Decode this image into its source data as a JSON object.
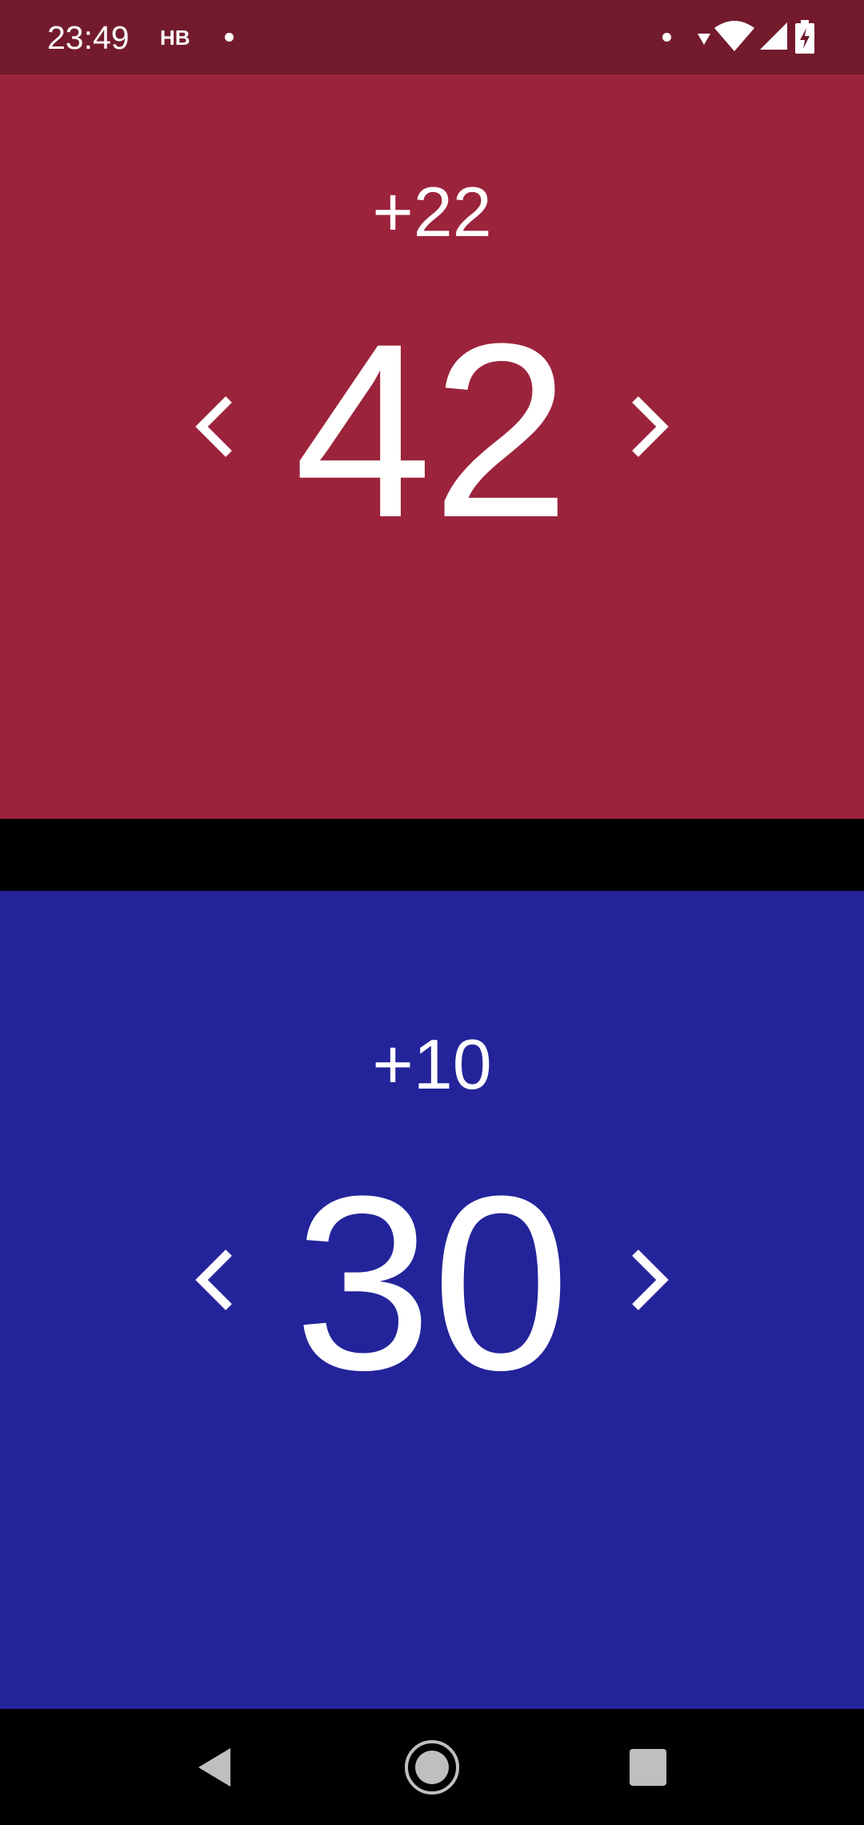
{
  "status_bar": {
    "time": "23:49",
    "carrier": "НВ",
    "background": "#731b2d",
    "icons": [
      "notification-dot-icon",
      "data-arrow-icon",
      "wifi-icon",
      "cell-signal-icon",
      "battery-charging-icon"
    ]
  },
  "player_top": {
    "delta": "+22",
    "score": "42",
    "background": "#9b233b",
    "decrement_icon": "chevron-left-icon",
    "increment_icon": "chevron-right-icon"
  },
  "player_bottom": {
    "delta": "+10",
    "score": "30",
    "background": "#23249a",
    "decrement_icon": "chevron-left-icon",
    "increment_icon": "chevron-right-icon"
  },
  "nav_bar": {
    "icons": [
      "back-icon",
      "home-icon",
      "recents-icon"
    ]
  }
}
